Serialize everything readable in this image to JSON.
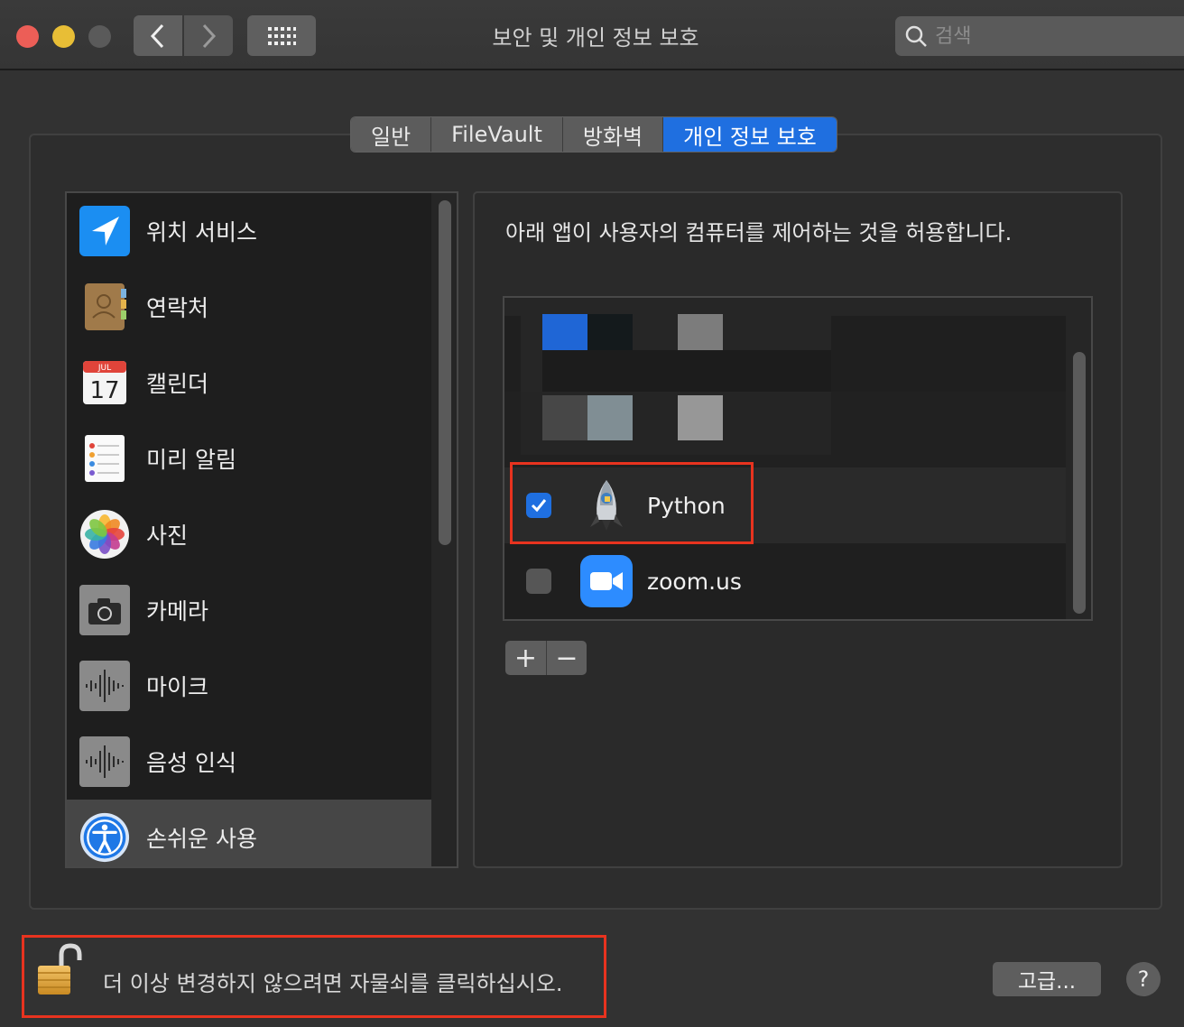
{
  "window": {
    "title": "보안 및 개인 정보 보호",
    "search_placeholder": "검색"
  },
  "tabs": [
    {
      "label": "일반",
      "active": false
    },
    {
      "label": "FileVault",
      "active": false
    },
    {
      "label": "방화벽",
      "active": false
    },
    {
      "label": "개인 정보 보호",
      "active": true
    }
  ],
  "sidebar": {
    "items": [
      {
        "label": "위치 서비스",
        "icon": "location-arrow-icon"
      },
      {
        "label": "연락처",
        "icon": "contacts-book-icon"
      },
      {
        "label": "캘린더",
        "icon": "calendar-icon",
        "calendar_month": "JUL",
        "calendar_day": "17"
      },
      {
        "label": "미리 알림",
        "icon": "reminders-icon"
      },
      {
        "label": "사진",
        "icon": "photos-flower-icon"
      },
      {
        "label": "카메라",
        "icon": "camera-icon"
      },
      {
        "label": "마이크",
        "icon": "microphone-waveform-icon"
      },
      {
        "label": "음성 인식",
        "icon": "speech-recognition-icon"
      },
      {
        "label": "손쉬운 사용",
        "icon": "accessibility-icon",
        "selected": true
      }
    ]
  },
  "panel": {
    "description": "아래 앱이 사용자의 컴퓨터를 제어하는 것을 허용합니다.",
    "apps": [
      {
        "name": "Python",
        "checked": true,
        "icon": "python-rocket-icon"
      },
      {
        "name": "zoom.us",
        "checked": false,
        "icon": "zoom-camera-icon"
      }
    ],
    "add_label": "+",
    "remove_label": "−"
  },
  "footer": {
    "lock_text": "더 이상 변경하지 않으려면 자물쇠를 클릭하십시오.",
    "advanced_label": "고급...",
    "help_label": "?"
  },
  "colors": {
    "accent": "#1f6fe0",
    "highlight_box": "#e8331f"
  }
}
